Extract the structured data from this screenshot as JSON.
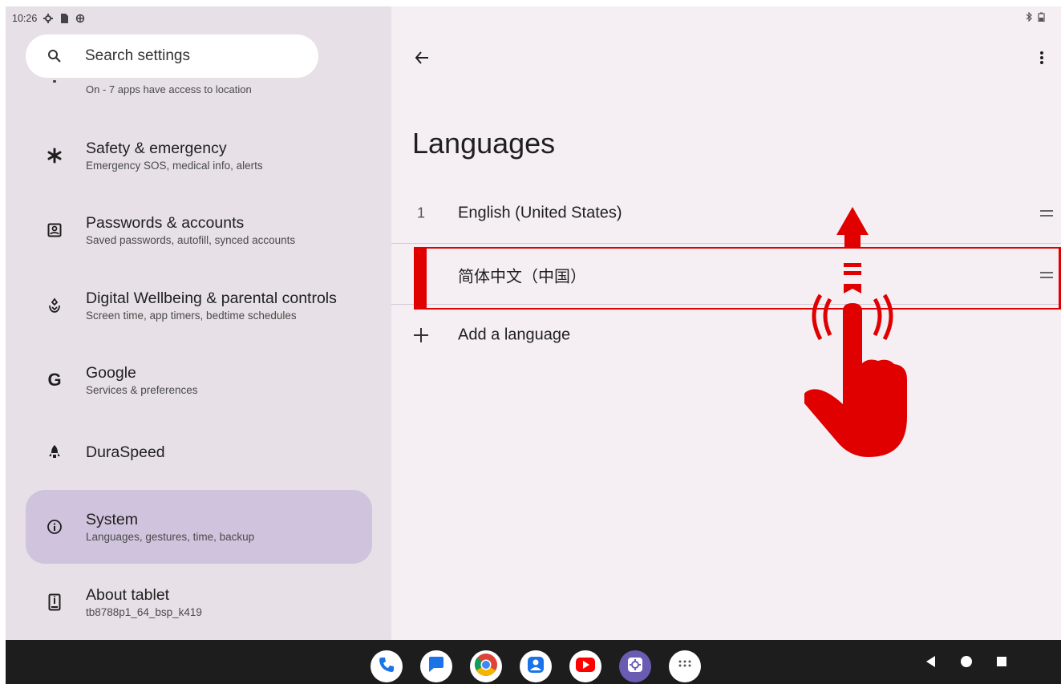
{
  "status_bar": {
    "time": "10:26"
  },
  "search": {
    "label": "Search settings"
  },
  "settings_list": {
    "location_subtitle": "On - 7 apps have access to location",
    "items": [
      {
        "title": "Safety & emergency",
        "subtitle": "Emergency SOS, medical info, alerts",
        "icon": "asterisk-icon"
      },
      {
        "title": "Passwords & accounts",
        "subtitle": "Saved passwords, autofill, synced accounts",
        "icon": "account-box-icon"
      },
      {
        "title": "Digital Wellbeing & parental controls",
        "subtitle": "Screen time, app timers, bedtime schedules",
        "icon": "wellbeing-icon"
      },
      {
        "title": "Google",
        "subtitle": "Services & preferences",
        "icon": "google-icon"
      },
      {
        "title": "DuraSpeed",
        "subtitle": "",
        "icon": "rocket-icon"
      },
      {
        "title": "System",
        "subtitle": "Languages, gestures, time, backup",
        "icon": "info-icon",
        "selected": true
      },
      {
        "title": "About tablet",
        "subtitle": "tb8788p1_64_bsp_k419",
        "icon": "tablet-icon"
      }
    ]
  },
  "languages_page": {
    "title": "Languages",
    "languages": [
      {
        "number": "1",
        "name": "English (United States)"
      },
      {
        "number": "",
        "name": "简体中文（中国）"
      }
    ],
    "add_language": "Add a language"
  },
  "colors": {
    "left_pane_bg": "#e7e0e6",
    "right_pane_bg": "#f5eff4",
    "selected_item_bg": "#d0c3dd",
    "highlight_red": "#e00000",
    "taskbar_bg": "#1d1d1d"
  },
  "taskbar": {
    "apps": [
      "phone-icon",
      "messages-icon",
      "chrome-icon",
      "contacts-icon",
      "youtube-icon",
      "settings-icon",
      "app-drawer-icon"
    ],
    "nav": [
      "back-nav-icon",
      "home-nav-icon",
      "recents-nav-icon"
    ]
  }
}
